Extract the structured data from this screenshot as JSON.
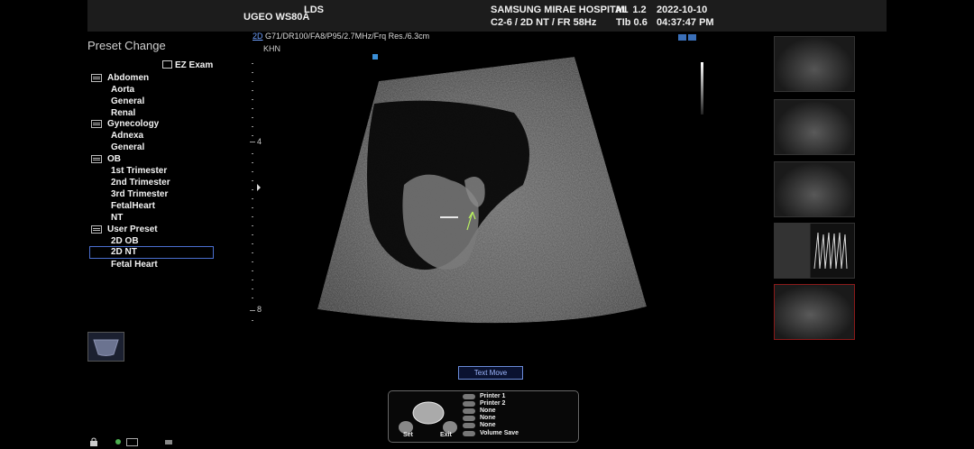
{
  "header": {
    "model": "UGEO WS80A",
    "user": "LDS",
    "hospital": "SAMSUNG MIRAE HOSPITAL",
    "probe_info": "C2-6 / 2D NT / FR 58Hz",
    "mi": "MI  1.2",
    "tib": "TIb 0.6",
    "date": "2022-10-10",
    "time": "04:37:47 PM"
  },
  "sidebar": {
    "title": "Preset Change",
    "ez_exam": "EZ Exam",
    "categories": [
      {
        "label": "Abdomen",
        "items": [
          "Aorta",
          "General",
          "Renal"
        ]
      },
      {
        "label": "Gynecology",
        "items": [
          "Adnexa",
          "General"
        ]
      },
      {
        "label": "OB",
        "items": [
          "1st Trimester",
          "2nd Trimester",
          "3rd Trimester",
          "FetalHeart",
          "NT"
        ]
      },
      {
        "label": "User Preset",
        "items": [
          "2D OB",
          "2D NT",
          "Fetal Heart"
        ]
      }
    ],
    "selected_item": "2D NT"
  },
  "image": {
    "mode": "2D",
    "params": "G71/DR100/FA8/P95/2.7MHz/Frq Res./6.3cm",
    "operator": "KHN",
    "depth_labels": [
      "4",
      "8"
    ]
  },
  "controls": {
    "text_move": "Text Move",
    "set_label": "Set",
    "exit_label": "Exit",
    "key_labels": [
      "Printer 1",
      "Printer 2",
      "None",
      "None",
      "None",
      "Volume Save"
    ]
  },
  "colors": {
    "accent": "#4a6fd0",
    "topbar": "#1c1c1c",
    "thumbnail_selected_border": "#8b1a1a"
  }
}
